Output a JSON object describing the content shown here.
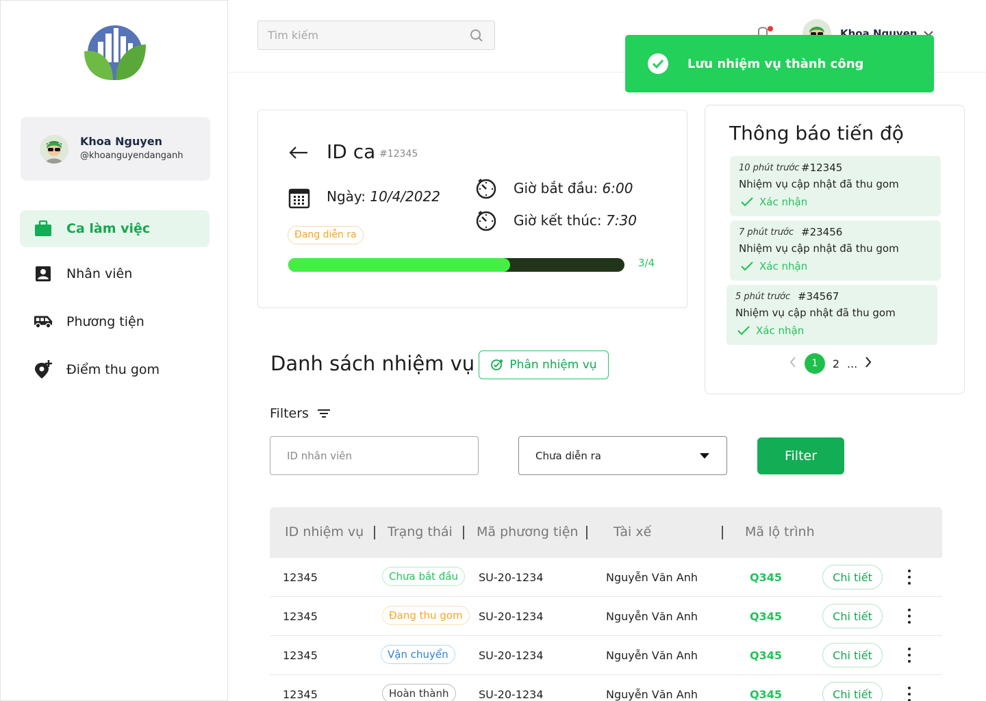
{
  "sidebar": {
    "profile": {
      "name": "Khoa Nguyen",
      "handle": "@khoanguyendanganh"
    },
    "items": [
      {
        "label": "Ca làm việc",
        "icon": "briefcase-icon",
        "active": true
      },
      {
        "label": "Nhân viên",
        "icon": "contact-card-icon",
        "active": false
      },
      {
        "label": "Phương tiện",
        "icon": "van-icon",
        "active": false
      },
      {
        "label": "Điểm thu gom",
        "icon": "add-location-icon",
        "active": false
      }
    ]
  },
  "header": {
    "search_placeholder": "Tìm kiếm",
    "user_name": "Khoa Nguyen"
  },
  "toast": {
    "message": "Lưu nhiệm vụ thành công",
    "color": "#22d05a"
  },
  "shift": {
    "title": "ID ca",
    "id": "#12345",
    "date_label": "Ngày: ",
    "date_value": "10/4/2022",
    "start_label": "Giờ bắt đầu: ",
    "start_value": "6:00",
    "end_label": "Giờ kết thúc: ",
    "end_value": "7:30",
    "status": "Đang diễn ra",
    "progress_text": "3/4",
    "progress_fraction": 0.66
  },
  "notifications": {
    "title": "Thông báo tiến độ",
    "items": [
      {
        "time": "10 phút trước",
        "id": "#12345",
        "message": "Nhiệm vụ cập nhật đã thu gom",
        "action": "Xác nhận"
      },
      {
        "time": "7 phút trước",
        "id": "#23456",
        "message": "Nhiệm vụ cập nhật đã thu gom",
        "action": "Xác nhận"
      },
      {
        "time": "5 phút trước",
        "id": "#34567",
        "message": "Nhiệm vụ cập nhật đã thu gom",
        "action": "Xác nhận"
      }
    ],
    "pagination": {
      "current": "1",
      "next": "2",
      "ellipsis": "..."
    }
  },
  "tasks": {
    "title": "Danh sách nhiệm vụ",
    "assign_label": "Phân nhiệm vụ",
    "filters_label": "Filters",
    "id_placeholder": "ID nhân viên",
    "status_selected": "Chưa diễn ra",
    "filter_button": "Filter",
    "columns": [
      "ID nhiệm vụ",
      "Trạng thái",
      "Mã phương tiện",
      "Tài xế",
      "Mã lộ trình"
    ],
    "rows": [
      {
        "id": "12345",
        "status": "Chưa bắt đầu",
        "status_color": "#22c45a",
        "vehicle": "SU-20-1234",
        "driver": "Nguyễn Văn Anh",
        "route": "Q345",
        "detail": "Chi tiết"
      },
      {
        "id": "12345",
        "status": "Đang thu gom",
        "status_color": "#f5a623",
        "vehicle": "SU-20-1234",
        "driver": "Nguyễn Văn Anh",
        "route": "Q345",
        "detail": "Chi tiết"
      },
      {
        "id": "12345",
        "status": "Vận chuyển",
        "status_color": "#2f7fd8",
        "vehicle": "SU-20-1234",
        "driver": "Nguyễn Văn Anh",
        "route": "Q345",
        "detail": "Chi tiết"
      },
      {
        "id": "12345",
        "status": "Hoàn thành",
        "status_color": "#333333",
        "vehicle": "SU-20-1234",
        "driver": "Nguyễn Văn Anh",
        "route": "Q345",
        "detail": "Chi tiết"
      }
    ]
  },
  "colors": {
    "brand_green": "#13ad55",
    "active_bg": "#e7f6ec"
  }
}
